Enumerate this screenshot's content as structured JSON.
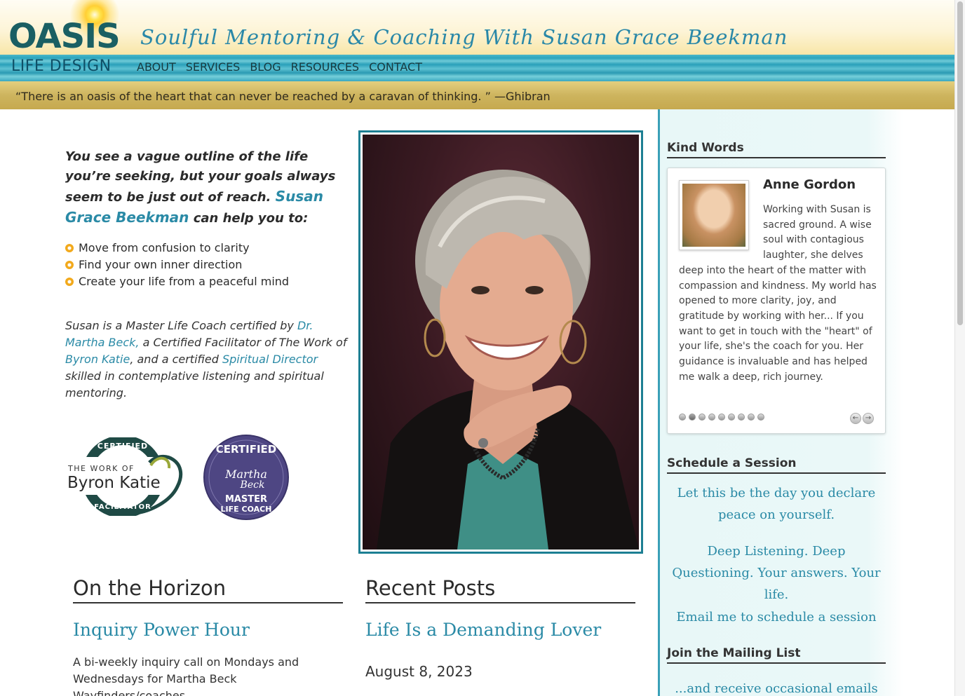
{
  "header": {
    "logo_top": "OASIS",
    "logo_bottom": "LIFE DESIGN",
    "tagline": "Soulful Mentoring & Coaching With Susan Grace Beekman",
    "nav": [
      "ABOUT",
      "SERVICES",
      "BLOG",
      "RESOURCES",
      "CONTACT"
    ],
    "quote": "“There is an oasis of the heart that can never be reached by a caravan of thinking. ” —Ghibran"
  },
  "intro": {
    "lead": "You see a vague outline of the life you’re seeking, but your goals always seem to be just out of reach.",
    "name": "Susan Grace Beekman",
    "tail": "can help you to:",
    "bullets": [
      "Move from confusion to clarity",
      "Find your own inner direction",
      "Create your life from a peaceful mind"
    ]
  },
  "bio": {
    "p1": "Susan is a Master Life Coach certified by",
    "link1": "Dr. Martha Beck,",
    "p2": "a Certified Facilitator of The Work of",
    "link2": "Byron Katie",
    "p3": ", and a certified",
    "link3": "Spiritual Director",
    "p4": "skilled in contemplative listening and spiritual mentoring."
  },
  "badges": {
    "katie": {
      "top": "CERTIFIED",
      "line1": "THE WORK OF",
      "line2": "Byron Katie",
      "bottom": "FACILITATOR"
    },
    "beck": {
      "top": "CERTIFIED",
      "line1": "Martha",
      "line2": "Beck",
      "bottom1": "MASTER",
      "bottom2": "LIFE COACH"
    }
  },
  "horizon": {
    "heading": "On the Horizon",
    "title": "Inquiry Power Hour",
    "text": "A bi-weekly inquiry call on Mondays and Wednesdays for Martha Beck Wayfinders/coaches..."
  },
  "recent": {
    "heading": "Recent Posts",
    "title": "Life Is a Demanding Lover",
    "date": "August 8, 2023"
  },
  "sidebar": {
    "kind_words": {
      "heading": "Kind Words",
      "name": "Anne Gordon",
      "text": "Working with Susan is sacred ground. A wise soul with contagious laughter, she delves deep into the heart of the matter with compassion and kindness. My world has opened to more clarity, joy, and gratitude by working with her... If you want to get in touch with the \"heart\" of your life, she's the coach for you. Her guidance is invaluable and has helped me walk a deep, rich journey.",
      "slide_count": 9,
      "active_slide": 2
    },
    "schedule": {
      "heading": "Schedule a Session",
      "line1": "Let this be the day you declare peace on yourself.",
      "line2": "Deep Listening. Deep Questioning. Your answers. Your life.",
      "link": "Email me to schedule a session"
    },
    "mailing": {
      "heading": "Join the Mailing List",
      "text": "...and receive occasional emails with"
    }
  },
  "colors": {
    "teal": "#2a8aa6",
    "frame": "#1d7f93",
    "dark_teal": "#1a5f63",
    "bullet": "#f2a91b"
  }
}
